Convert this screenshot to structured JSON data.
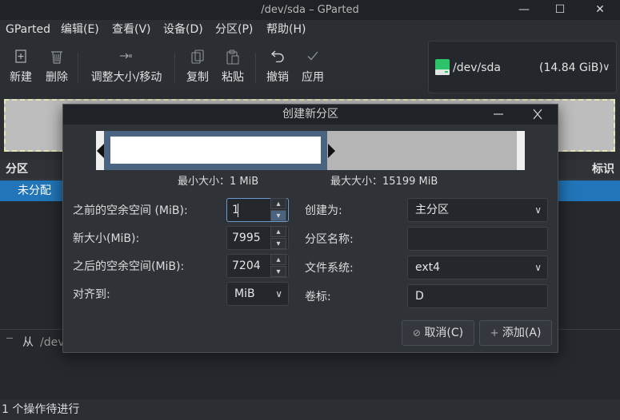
{
  "window": {
    "title": "/dev/sda  –  GParted",
    "minimize_glyph": "—",
    "maximize_glyph": "☐",
    "close_glyph": "✕"
  },
  "menu": [
    "GParted",
    "编辑(E)",
    "查看(V)",
    "设备(D)",
    "分区(P)",
    "帮助(H)"
  ],
  "toolbar": {
    "new_label": "新建",
    "delete_label": "删除",
    "resize_label": "调整大小/移动",
    "copy_label": "复制",
    "paste_label": "粘贴",
    "undo_label": "撤销",
    "apply_label": "应用"
  },
  "device": {
    "name": "/dev/sda",
    "size": "(14.84  GiB)",
    "arrow": "∨"
  },
  "list": {
    "col_partition": "分区",
    "col_flags": "标识",
    "row_partition": "未分配"
  },
  "pending": {
    "from_label": "从",
    "path_fragment": "/dev"
  },
  "status": {
    "text": "1 个操作待进行"
  },
  "dialog": {
    "title": "创建新分区",
    "min_size": "最小大小：1  MiB",
    "max_size": "最大大小：15199  MiB",
    "labels": {
      "free_before": "之前的空余空间 (MiB):",
      "new_size": "新大小(MiB):",
      "free_after": "之后的空余空间(MiB):",
      "align_to": "对齐到:",
      "create_as": "创建为:",
      "partition_name": "分区名称:",
      "filesystem": "文件系统:",
      "label": "卷标:"
    },
    "values": {
      "free_before": "1",
      "new_size": "7995",
      "free_after": "7204",
      "align_to": "MiB",
      "create_as": "主分区",
      "partition_name": "",
      "filesystem": "ext4",
      "label": "D"
    },
    "cancel_label": "取消(C)",
    "add_label": "添加(A)",
    "preview": {
      "used_fraction": 0.526,
      "free_fraction": 0.474
    }
  },
  "colors": {
    "accent": "#2175b8",
    "dialog_bg": "#2f3338",
    "preview_border": "#4a6380"
  }
}
